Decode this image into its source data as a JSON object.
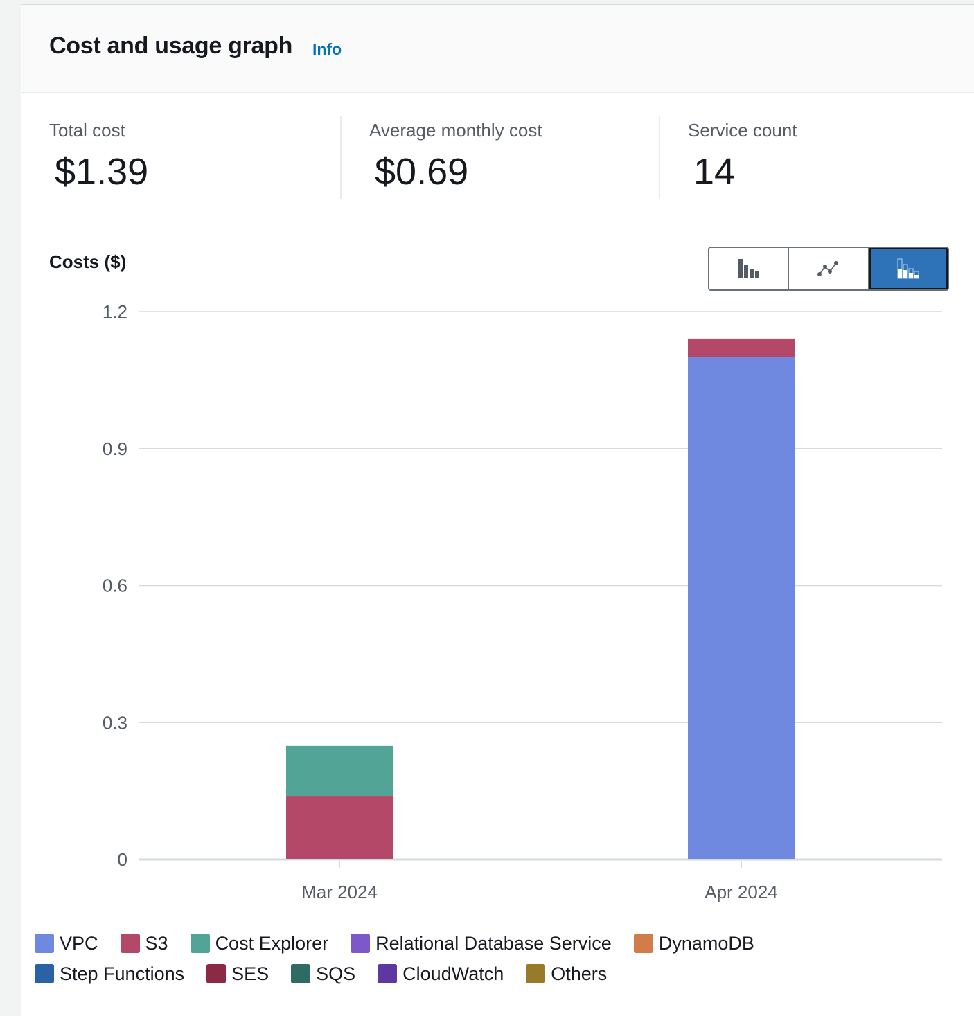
{
  "header": {
    "title": "Cost and usage graph",
    "info_label": "Info"
  },
  "kpis": [
    {
      "label": "Total cost",
      "value": "$1.39"
    },
    {
      "label": "Average monthly cost",
      "value": "$0.69"
    },
    {
      "label": "Service count",
      "value": "14"
    }
  ],
  "chart_controls": {
    "options": [
      {
        "name": "bar-chart",
        "selected": false
      },
      {
        "name": "line-chart",
        "selected": false
      },
      {
        "name": "stacked-bar-chart",
        "selected": true
      }
    ]
  },
  "legend": {
    "rows": [
      [
        0,
        1,
        2,
        3,
        4
      ],
      [
        5,
        6,
        7,
        8,
        9
      ]
    ]
  },
  "chart_data": {
    "type": "bar",
    "stacked": true,
    "title": "",
    "xlabel": "",
    "ylabel": "Costs ($)",
    "ylim": [
      0,
      1.2
    ],
    "yticks": [
      0,
      0.3,
      0.6,
      0.9,
      1.2
    ],
    "ytick_labels": [
      "0",
      "0.3",
      "0.6",
      "0.9",
      "1.2"
    ],
    "grid": true,
    "legend_position": "bottom",
    "categories": [
      "Mar 2024",
      "Apr 2024"
    ],
    "series": [
      {
        "name": "VPC",
        "color": "#6f89e0",
        "values": [
          0,
          1.1
        ]
      },
      {
        "name": "S3",
        "color": "#b44868",
        "values": [
          0.138,
          0.041
        ]
      },
      {
        "name": "Cost Explorer",
        "color": "#52a496",
        "values": [
          0.111,
          0
        ]
      },
      {
        "name": "Relational Database Service",
        "color": "#7c58c8",
        "values": [
          0,
          0
        ]
      },
      {
        "name": "DynamoDB",
        "color": "#d27c4a",
        "values": [
          0,
          0
        ]
      },
      {
        "name": "Step Functions",
        "color": "#2a63a5",
        "values": [
          0,
          0
        ]
      },
      {
        "name": "SES",
        "color": "#8b2947",
        "values": [
          0,
          0
        ]
      },
      {
        "name": "SQS",
        "color": "#2e6b62",
        "values": [
          0,
          0
        ]
      },
      {
        "name": "CloudWatch",
        "color": "#5d38a0",
        "values": [
          0,
          0
        ]
      },
      {
        "name": "Others",
        "color": "#987a2b",
        "values": [
          0,
          0
        ]
      }
    ]
  }
}
